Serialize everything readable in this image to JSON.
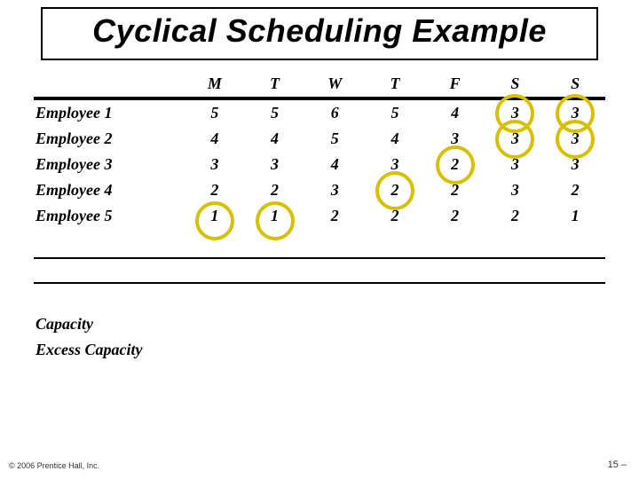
{
  "title": "Cyclical Scheduling Example",
  "chart_data": {
    "type": "table",
    "columns": [
      "M",
      "T",
      "W",
      "T",
      "F",
      "S",
      "S"
    ],
    "rows": [
      {
        "label": "Employee 1",
        "values": [
          5,
          5,
          6,
          5,
          4,
          3,
          3
        ],
        "circled": [
          false,
          false,
          false,
          false,
          false,
          true,
          true
        ]
      },
      {
        "label": "Employee 2",
        "values": [
          4,
          4,
          5,
          4,
          3,
          3,
          3
        ],
        "circled": [
          false,
          false,
          false,
          false,
          false,
          true,
          true
        ]
      },
      {
        "label": "Employee 3",
        "values": [
          3,
          3,
          4,
          3,
          2,
          3,
          3
        ],
        "circled": [
          false,
          false,
          false,
          false,
          true,
          false,
          false
        ]
      },
      {
        "label": "Employee 4",
        "values": [
          2,
          2,
          3,
          2,
          2,
          3,
          2
        ],
        "circled": [
          false,
          false,
          false,
          true,
          false,
          false,
          false
        ]
      },
      {
        "label": "Employee 5",
        "values": [
          1,
          1,
          2,
          2,
          2,
          2,
          1
        ],
        "circled": [
          true,
          true,
          false,
          false,
          false,
          false,
          false
        ]
      }
    ]
  },
  "footer_labels": {
    "capacity": "Capacity",
    "excess_capacity": "Excess Capacity"
  },
  "footer": {
    "left": "© 2006 Prentice Hall, Inc.",
    "right": "15 –"
  }
}
